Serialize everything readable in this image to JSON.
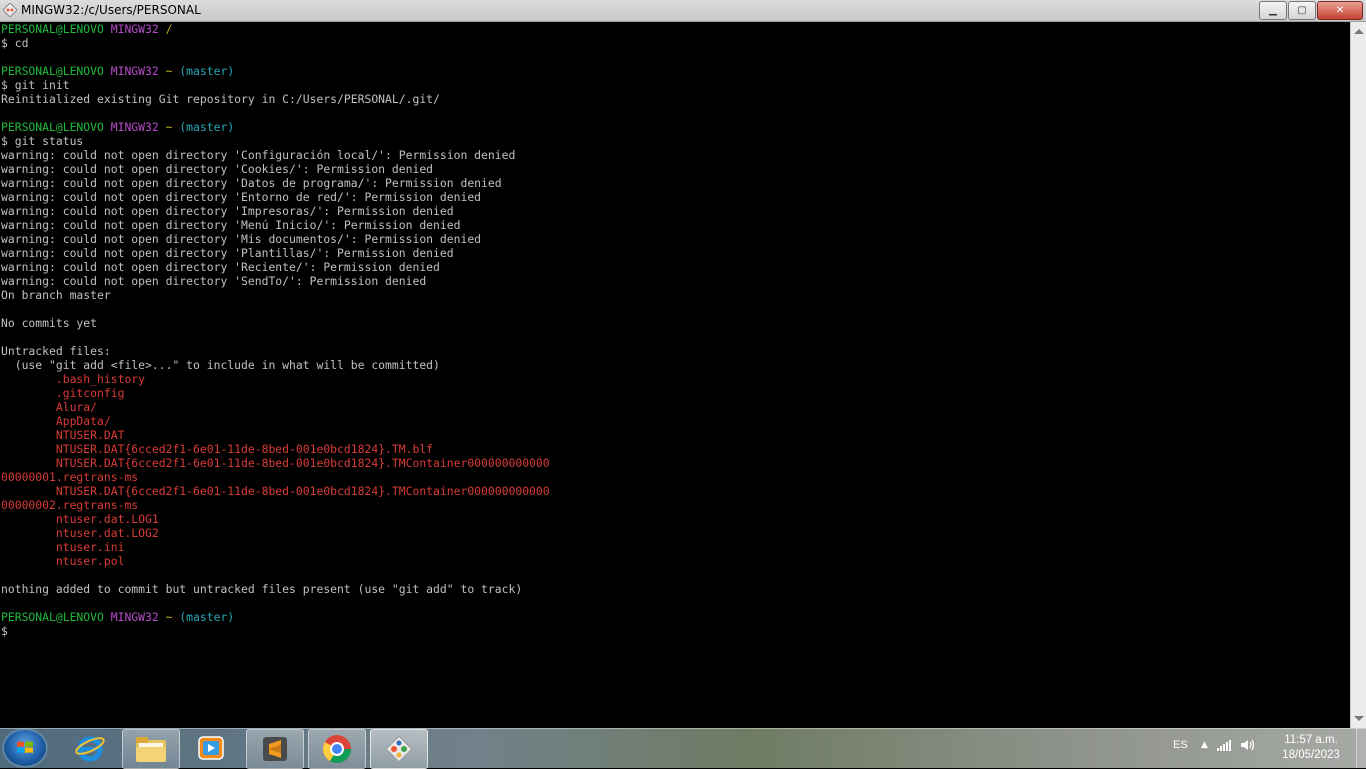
{
  "window": {
    "title": "MINGW32:/c/Users/PERSONAL",
    "controls": {
      "minimize": "▁",
      "maximize": "▢",
      "close": "✕"
    }
  },
  "terminal": {
    "lines": [
      {
        "type": "prompt",
        "user": "PERSONAL@LENOVO",
        "host": "MINGW32",
        "path": "/",
        "branch": ""
      },
      {
        "type": "text",
        "text": "$ cd"
      },
      {
        "type": "blank"
      },
      {
        "type": "prompt",
        "user": "PERSONAL@LENOVO",
        "host": "MINGW32",
        "path": "~",
        "branch": "(master)"
      },
      {
        "type": "text",
        "text": "$ git init"
      },
      {
        "type": "text",
        "text": "Reinitialized existing Git repository in C:/Users/PERSONAL/.git/"
      },
      {
        "type": "blank"
      },
      {
        "type": "prompt",
        "user": "PERSONAL@LENOVO",
        "host": "MINGW32",
        "path": "~",
        "branch": "(master)"
      },
      {
        "type": "text",
        "text": "$ git status"
      },
      {
        "type": "text",
        "text": "warning: could not open directory 'Configuración local/': Permission denied"
      },
      {
        "type": "text",
        "text": "warning: could not open directory 'Cookies/': Permission denied"
      },
      {
        "type": "text",
        "text": "warning: could not open directory 'Datos de programa/': Permission denied"
      },
      {
        "type": "text",
        "text": "warning: could not open directory 'Entorno de red/': Permission denied"
      },
      {
        "type": "text",
        "text": "warning: could not open directory 'Impresoras/': Permission denied"
      },
      {
        "type": "text",
        "text": "warning: could not open directory 'Menú Inicio/': Permission denied"
      },
      {
        "type": "text",
        "text": "warning: could not open directory 'Mis documentos/': Permission denied"
      },
      {
        "type": "text",
        "text": "warning: could not open directory 'Plantillas/': Permission denied"
      },
      {
        "type": "text",
        "text": "warning: could not open directory 'Reciente/': Permission denied"
      },
      {
        "type": "text",
        "text": "warning: could not open directory 'SendTo/': Permission denied"
      },
      {
        "type": "text",
        "text": "On branch master"
      },
      {
        "type": "blank"
      },
      {
        "type": "text",
        "text": "No commits yet"
      },
      {
        "type": "blank"
      },
      {
        "type": "text",
        "text": "Untracked files:"
      },
      {
        "type": "text",
        "text": "  (use \"git add <file>...\" to include in what will be committed)"
      },
      {
        "type": "file",
        "text": "        .bash_history"
      },
      {
        "type": "file",
        "text": "        .gitconfig"
      },
      {
        "type": "file",
        "text": "        Alura/"
      },
      {
        "type": "file",
        "text": "        AppData/"
      },
      {
        "type": "file",
        "text": "        NTUSER.DAT"
      },
      {
        "type": "file",
        "text": "        NTUSER.DAT{6cced2f1-6e01-11de-8bed-001e0bcd1824}.TM.blf"
      },
      {
        "type": "file",
        "text": "        NTUSER.DAT{6cced2f1-6e01-11de-8bed-001e0bcd1824}.TMContainer000000000000"
      },
      {
        "type": "file",
        "text": "00000001.regtrans-ms"
      },
      {
        "type": "file",
        "text": "        NTUSER.DAT{6cced2f1-6e01-11de-8bed-001e0bcd1824}.TMContainer000000000000"
      },
      {
        "type": "file",
        "text": "00000002.regtrans-ms"
      },
      {
        "type": "file",
        "text": "        ntuser.dat.LOG1"
      },
      {
        "type": "file",
        "text": "        ntuser.dat.LOG2"
      },
      {
        "type": "file",
        "text": "        ntuser.ini"
      },
      {
        "type": "file",
        "text": "        ntuser.pol"
      },
      {
        "type": "blank"
      },
      {
        "type": "text",
        "text": "nothing added to commit but untracked files present (use \"git add\" to track)"
      },
      {
        "type": "blank"
      },
      {
        "type": "prompt",
        "user": "PERSONAL@LENOVO",
        "host": "MINGW32",
        "path": "~",
        "branch": "(master)"
      },
      {
        "type": "text",
        "text": "$"
      }
    ],
    "colors": {
      "user": "#1fba3a",
      "host": "#b54dc8",
      "path": "#c7b221",
      "branch": "#28a7b4",
      "untracked": "#d83b36",
      "text": "#c0c0c0"
    }
  },
  "taskbar": {
    "apps": [
      {
        "name": "internet-explorer",
        "icon": "internet-explorer-icon"
      },
      {
        "name": "file-explorer",
        "icon": "folder-icon"
      },
      {
        "name": "media-player",
        "icon": "media-player-icon"
      },
      {
        "name": "sublime-text",
        "icon": "sublime-text-icon"
      },
      {
        "name": "chrome",
        "icon": "chrome-icon"
      },
      {
        "name": "git-bash",
        "icon": "git-icon"
      }
    ],
    "language": "ES",
    "time": "11:57 a.m.",
    "date": "18/05/2023"
  }
}
